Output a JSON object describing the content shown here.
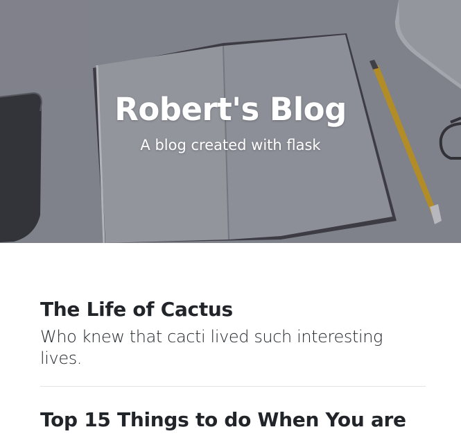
{
  "header": {
    "title": "Robert's Blog",
    "subtitle": "A blog created with flask"
  },
  "posts": [
    {
      "title": "The Life of Cactus",
      "subtitle": "Who knew that cacti lived such interesting lives."
    },
    {
      "title": "Top 15 Things to do When You are"
    }
  ]
}
